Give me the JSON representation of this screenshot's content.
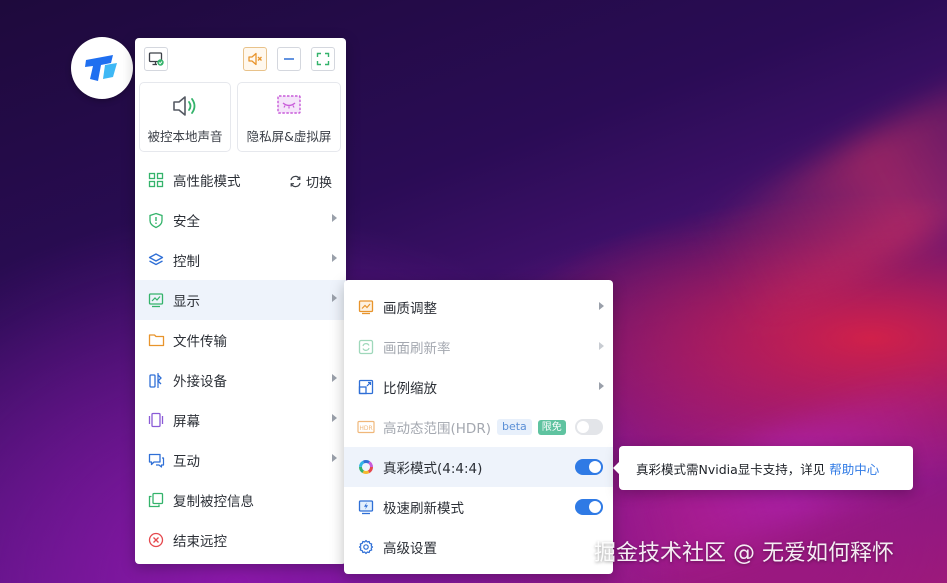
{
  "app": {
    "logo": "todesk-logo"
  },
  "topbar": {
    "monitor_icon": "monitor-check-icon",
    "mute_icon": "speaker-mute-icon",
    "minimize_icon": "minimize-icon",
    "fullscreen_icon": "fullscreen-icon"
  },
  "tiles": [
    {
      "label": "被控本地声音",
      "icon": "speaker-sound-icon"
    },
    {
      "label": "隐私屏&虚拟屏",
      "icon": "privacy-screen-icon"
    }
  ],
  "menu": {
    "items": [
      {
        "label": "高性能模式",
        "icon": "grid-icon",
        "action": "切换"
      },
      {
        "label": "安全",
        "icon": "shield-icon"
      },
      {
        "label": "控制",
        "icon": "layers-icon"
      },
      {
        "label": "显示",
        "icon": "display-chart-icon"
      },
      {
        "label": "文件传输",
        "icon": "folder-icon"
      },
      {
        "label": "外接设备",
        "icon": "usb-device-icon"
      },
      {
        "label": "屏幕",
        "icon": "screen-icon"
      },
      {
        "label": "互动",
        "icon": "chat-icon"
      },
      {
        "label": "复制被控信息",
        "icon": "copy-icon"
      },
      {
        "label": "结束远控",
        "icon": "close-circle-icon"
      }
    ]
  },
  "display_submenu": {
    "items": [
      {
        "label": "画质调整",
        "icon": "image-quality-icon"
      },
      {
        "label": "画面刷新率",
        "icon": "refresh-icon"
      },
      {
        "label": "比例缩放",
        "icon": "scale-icon"
      },
      {
        "label": "高动态范围(HDR)",
        "icon": "hdr-icon",
        "badge_beta": "beta",
        "badge_free": "限免",
        "enabled": false
      },
      {
        "label": "真彩模式(4:4:4)",
        "icon": "color-wheel-icon",
        "enabled": true
      },
      {
        "label": "极速刷新模式",
        "icon": "lightning-screen-icon",
        "enabled": true
      },
      {
        "label": "高级设置",
        "icon": "gear-icon"
      }
    ]
  },
  "tooltip": {
    "text": "真彩模式需Nvidia显卡支持，详见",
    "link": "帮助中心"
  },
  "watermark": "掘金技术社区 @ 无爱如何释怀",
  "colors": {
    "accent": "#2f7ae5",
    "green": "#34b36b",
    "orange": "#e8942c"
  }
}
